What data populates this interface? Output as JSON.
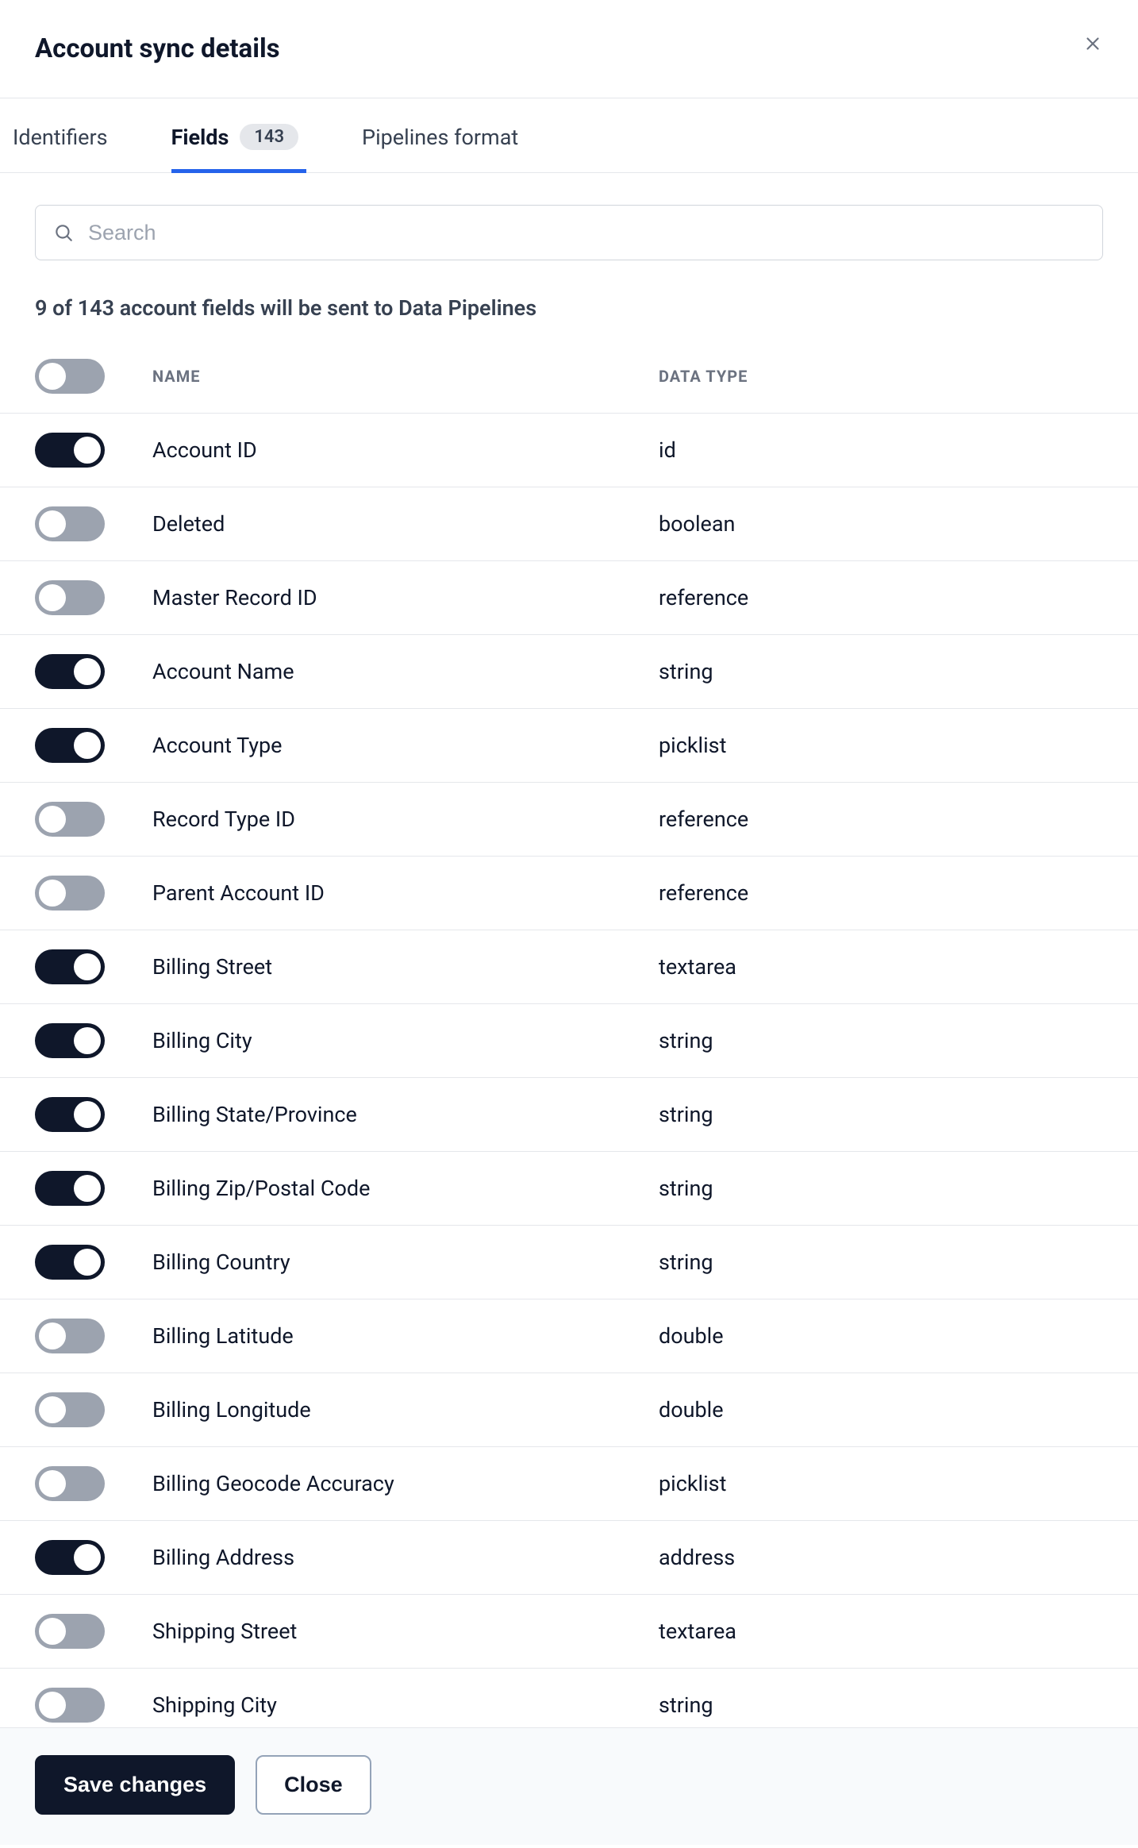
{
  "header": {
    "title": "Account sync details"
  },
  "tabs": {
    "identifiers": "Identifiers",
    "fields": "Fields",
    "fields_count": "143",
    "pipelines": "Pipelines format"
  },
  "search": {
    "placeholder": "Search"
  },
  "summary": "9 of 143 account fields will be sent to Data Pipelines",
  "columns": {
    "name": "NAME",
    "type": "DATA TYPE"
  },
  "fields": [
    {
      "on": true,
      "name": "Account ID",
      "type": "id"
    },
    {
      "on": false,
      "name": "Deleted",
      "type": "boolean"
    },
    {
      "on": false,
      "name": "Master Record ID",
      "type": "reference"
    },
    {
      "on": true,
      "name": "Account Name",
      "type": "string"
    },
    {
      "on": true,
      "name": "Account Type",
      "type": "picklist"
    },
    {
      "on": false,
      "name": "Record Type ID",
      "type": "reference"
    },
    {
      "on": false,
      "name": "Parent Account ID",
      "type": "reference"
    },
    {
      "on": true,
      "name": "Billing Street",
      "type": "textarea"
    },
    {
      "on": true,
      "name": "Billing City",
      "type": "string"
    },
    {
      "on": true,
      "name": "Billing State/Province",
      "type": "string"
    },
    {
      "on": true,
      "name": "Billing Zip/Postal Code",
      "type": "string"
    },
    {
      "on": true,
      "name": "Billing Country",
      "type": "string"
    },
    {
      "on": false,
      "name": "Billing Latitude",
      "type": "double"
    },
    {
      "on": false,
      "name": "Billing Longitude",
      "type": "double"
    },
    {
      "on": false,
      "name": "Billing Geocode Accuracy",
      "type": "picklist"
    },
    {
      "on": true,
      "name": "Billing Address",
      "type": "address"
    },
    {
      "on": false,
      "name": "Shipping Street",
      "type": "textarea"
    },
    {
      "on": false,
      "name": "Shipping City",
      "type": "string"
    }
  ],
  "footer": {
    "save": "Save changes",
    "close": "Close"
  }
}
